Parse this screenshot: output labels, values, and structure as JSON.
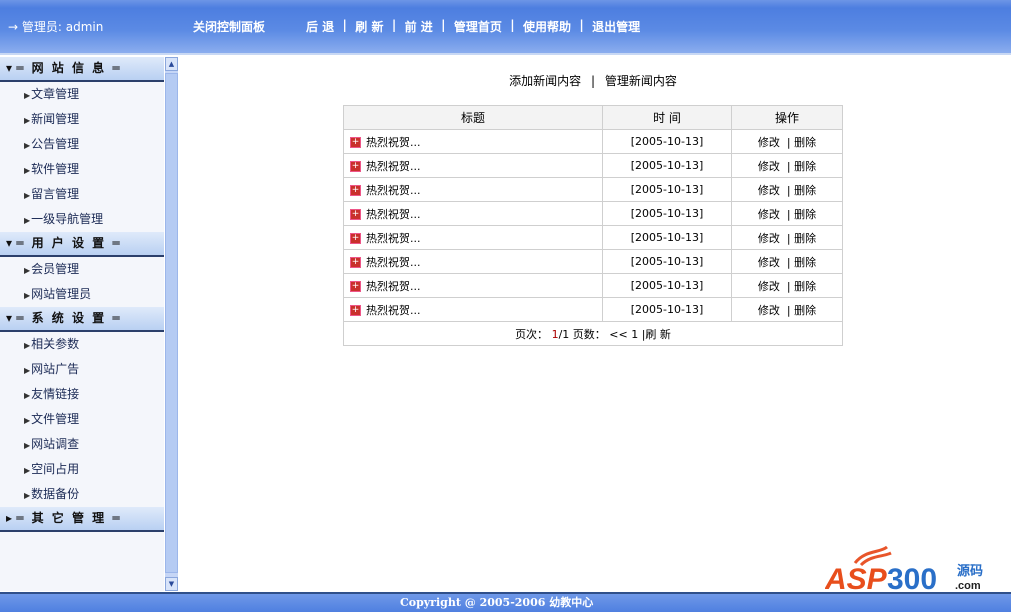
{
  "header": {
    "admin": "→ 管理员: admin",
    "close": "关闭控制面板",
    "nav": [
      "后 退",
      "刷 新",
      "前 进",
      "管理首页",
      "使用帮助",
      "退出管理"
    ]
  },
  "sidebar": [
    {
      "title": "═ 网 站 信 息 ═",
      "icon": "collapse",
      "items": [
        "文章管理",
        "新闻管理",
        "公告管理",
        "软件管理",
        "留言管理",
        "一级导航管理"
      ]
    },
    {
      "title": "═ 用 户 设 置 ═",
      "icon": "collapse",
      "items": [
        "会员管理",
        "网站管理员"
      ]
    },
    {
      "title": "═ 系 统 设 置 ═",
      "icon": "collapse",
      "items": [
        "相关参数",
        "网站广告",
        "友情链接",
        "文件管理",
        "网站调查",
        "空间占用",
        "数据备份"
      ]
    },
    {
      "title": "═ 其 它 管 理 ═",
      "icon": "expand",
      "items": []
    }
  ],
  "links": {
    "add": "添加新闻内容",
    "manage": "管理新闻内容"
  },
  "table": {
    "headers": [
      "标题",
      "时 间",
      "操作"
    ],
    "rows": [
      {
        "title": "热烈祝贺...",
        "date": "[2005-10-13]",
        "edit": "修改",
        "del": "删除"
      },
      {
        "title": "热烈祝贺...",
        "date": "[2005-10-13]",
        "edit": "修改",
        "del": "删除"
      },
      {
        "title": "热烈祝贺...",
        "date": "[2005-10-13]",
        "edit": "修改",
        "del": "删除"
      },
      {
        "title": "热烈祝贺...",
        "date": "[2005-10-13]",
        "edit": "修改",
        "del": "删除"
      },
      {
        "title": "热烈祝贺...",
        "date": "[2005-10-13]",
        "edit": "修改",
        "del": "删除"
      },
      {
        "title": "热烈祝贺...",
        "date": "[2005-10-13]",
        "edit": "修改",
        "del": "删除"
      },
      {
        "title": "热烈祝贺...",
        "date": "[2005-10-13]",
        "edit": "修改",
        "del": "删除"
      },
      {
        "title": "热烈祝贺...",
        "date": "[2005-10-13]",
        "edit": "修改",
        "del": "删除"
      }
    ]
  },
  "pager": {
    "label": "页次：",
    "current": "1",
    "total": "/1",
    "pages_label": "页数：",
    "prev": "<<",
    "page": "1",
    "refresh": "|刷 新"
  },
  "footer": "Copyright @ 2005-2006 幼教中心",
  "logo": {
    "text": "ASP300",
    "sub": "源码",
    "domain": ".com"
  }
}
